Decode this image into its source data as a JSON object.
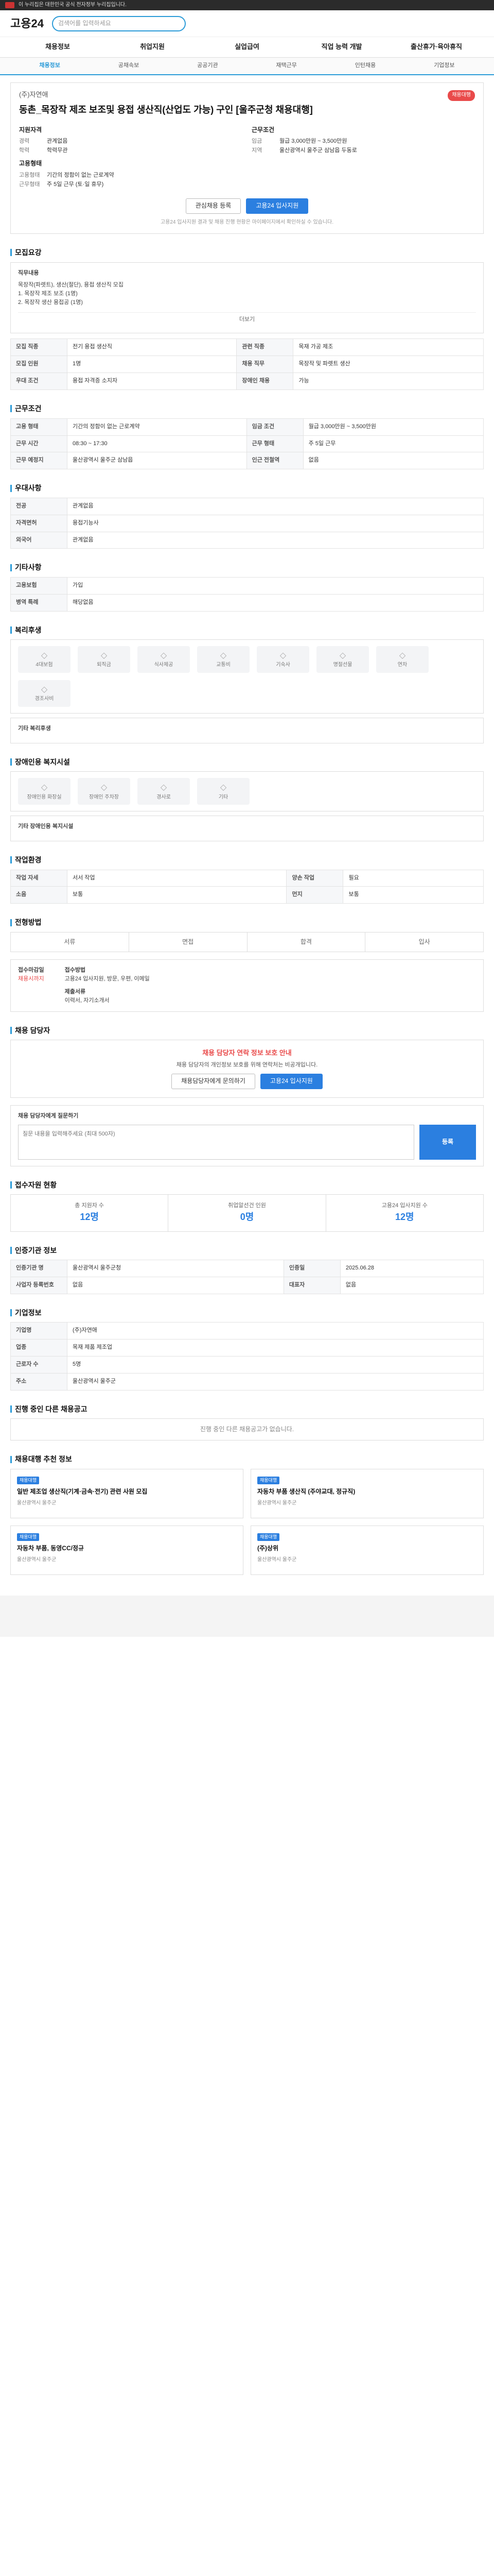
{
  "topbar": {
    "text": "이 누리집은 대한민국 공식 전자정부 누리집입니다."
  },
  "header": {
    "logo": "고용24",
    "search_placeholder": "검색어를 입력하세요"
  },
  "gnb": [
    "채용정보",
    "취업지원",
    "실업급여",
    "직업 능력 개발",
    "출산휴가·육아휴직"
  ],
  "subnav": [
    "채용정보",
    "공채속보",
    "공공기관",
    "재택근무",
    "인턴채용",
    "기업정보"
  ],
  "job": {
    "corp": "(주)자연애",
    "title": "동촌_목장작 제조 보조및 용접 생산직(산업도 가능) 구인 [울주군청 채용대행]",
    "badge": "채용대행",
    "h1": "지원자격",
    "h2": "근무조건",
    "h3": "고용형태",
    "q": [
      [
        "경력",
        "관계없음"
      ],
      [
        "학력",
        "학력무관"
      ]
    ],
    "w": [
      [
        "임금",
        "월급 3,000만원 ~ 3,500만원"
      ],
      [
        "지역",
        "울산광역시 울주군 삼남읍 두동로"
      ]
    ],
    "e": [
      [
        "고용형태",
        "기간의 정함이 없는 근로계약"
      ],
      [
        "근무형태",
        "주 5일 근무 (토·일 휴무)"
      ]
    ],
    "btn_save": "관심채용 등록",
    "btn_apply": "고용24 입사지원",
    "note": "고용24 입사지원 결과 및 채용 진행 현황은 마이페이지에서 확인하실 수 있습니다."
  },
  "s_recruit": {
    "h": "모집요강",
    "title": "직무내용",
    "lines": [
      "목장작(파렛트), 생산(절단), 용접 생산직 모집",
      "1. 목장작 제조 보조 (1명)",
      "2. 목장작 생산 용접공 (1명)"
    ],
    "more": "더보기"
  },
  "t1": [
    [
      "모집 직종",
      "전기 용접 생산직",
      "관련 직종",
      "목재 가공 제조"
    ],
    [
      "모집 인원",
      "1명",
      "채용 직무",
      "목장작 및 파렛트 생산"
    ],
    [
      "우대 조건",
      "용접 자격증 소지자",
      "장애인 채용",
      "가능"
    ]
  ],
  "s_cond": {
    "h": "근무조건"
  },
  "t2": [
    [
      "고용 형태",
      "기간의 정함이 없는 근로계약",
      "임금 조건",
      "월급 3,000만원 ~ 3,500만원"
    ],
    [
      "근무 시간",
      "08:30 ~ 17:30",
      "근무 형태",
      "주 5일 근무"
    ],
    [
      "근무 예정지",
      "울산광역시 울주군 삼남읍",
      "인근 전철역",
      "없음"
    ]
  ],
  "s_etc": {
    "h": "우대사항"
  },
  "t3": [
    [
      "전공",
      "관계없음"
    ],
    [
      "자격면허",
      "용접기능사"
    ],
    [
      "외국어",
      "관계없음"
    ]
  ],
  "s_other": {
    "h": "기타사항",
    "rows": [
      [
        "고용보험",
        "가입"
      ],
      [
        "병역 특례",
        "해당없음"
      ]
    ]
  },
  "s_welfare": {
    "h": "복리후생",
    "items": [
      "4대보험",
      "퇴직금",
      "식사제공",
      "교통비",
      "기숙사",
      "명절선물",
      "연차",
      "경조사비"
    ],
    "title": "기타 복리후생"
  },
  "s_disab": {
    "h": "장애인용 복지시설",
    "items": [
      "장애인용 화장실",
      "장애인 주차장",
      "경사로",
      "기타"
    ],
    "title": "기타 장애인용 복지시설"
  },
  "s_env": {
    "h": "작업환경",
    "t": [
      [
        "작업 자세",
        "서서 작업",
        "양손 작업",
        "필요"
      ],
      [
        "소음",
        "보통",
        "먼지",
        "보통"
      ]
    ]
  },
  "s_proc": {
    "h": "전형방법",
    "tabs": [
      "서류",
      "면접",
      "합격",
      "입사"
    ]
  },
  "s_apply": {
    "h1": "접수마감일",
    "v1": "채용시까지",
    "h2": "접수방법",
    "v2": "고용24 입사지원, 방문, 우편, 이메일",
    "h3": "제출서류",
    "v3": "이력서, 자기소개서"
  },
  "s_contact": {
    "h": "채용 담당자",
    "alert": "채용 담당자 연락 정보 보호 안내",
    "msg": "채용 담당자의 개인정보 보호를 위해 연락처는 비공개입니다.",
    "b1": "채용담당자에게 문의하기",
    "b2": "고용24 입사지원"
  },
  "s_qa": {
    "h": "채용 담당자에게 질문하기",
    "placeholder": "질문 내용을 입력해주세요 (최대 500자)",
    "btn": "등록"
  },
  "s_stats": {
    "h": "접수자원 현황",
    "items": [
      [
        "총 지원자 수",
        "12명"
      ],
      [
        "취업알선건 인원",
        "0명"
      ],
      [
        "고용24 입사지원 수",
        "12명"
      ]
    ]
  },
  "s_corp": {
    "h": "인증기관 정보",
    "t": [
      [
        "인증기관 명",
        "울산광역시 울주군청",
        "인증일",
        "2025.06.28"
      ],
      [
        "사업자 등록번호",
        "없음",
        "대표자",
        "없음"
      ]
    ]
  },
  "s_company": {
    "h": "기업정보",
    "t": [
      [
        "기업명",
        "(주)자연애"
      ],
      [
        "업종",
        "목재 제품 제조업"
      ],
      [
        "근로자 수",
        "5명"
      ],
      [
        "주소",
        "울산광역시 울주군"
      ]
    ]
  },
  "s_similar": {
    "h": "진행 중인 다른 채용공고",
    "none": "진행 중인 다른 채용공고가 없습니다."
  },
  "s_reco": {
    "h": "채용대행 추천 정보",
    "cards": [
      {
        "tag": "채용대행",
        "t": "일반 제조업 생산직(기계·금속·전기) 관련 사원 모집",
        "m": "울산광역시 울주군"
      },
      {
        "tag": "채용대행",
        "t": "자동차 부품 생산직 (주야교대, 정규직)",
        "m": "울산광역시 울주군"
      },
      {
        "tag": "채용대행",
        "t": "자동차 부품, 동영CC/정규",
        "m": "울산광역시 울주군"
      },
      {
        "tag": "채용대행",
        "t": "(주)상위",
        "m": "울산광역시 울주군"
      }
    ]
  }
}
